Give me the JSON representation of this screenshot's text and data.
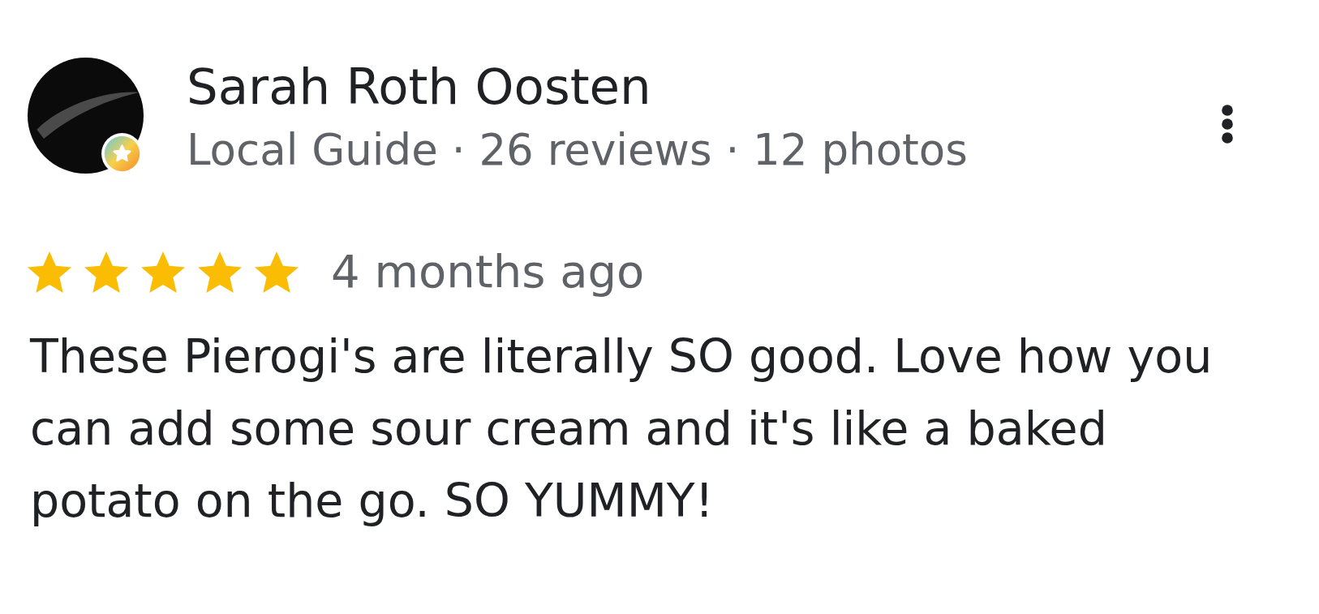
{
  "reviewer": {
    "name": "Sarah Roth Oosten",
    "guide_badge": true,
    "meta": "Local Guide · 26 reviews · 12 photos"
  },
  "rating": {
    "stars": 5,
    "time": "4 months ago"
  },
  "review_text": "These Pierogi's are literally SO good. Love how you can add some sour cream and it's like a baked potato on the go. SO YUMMY!"
}
